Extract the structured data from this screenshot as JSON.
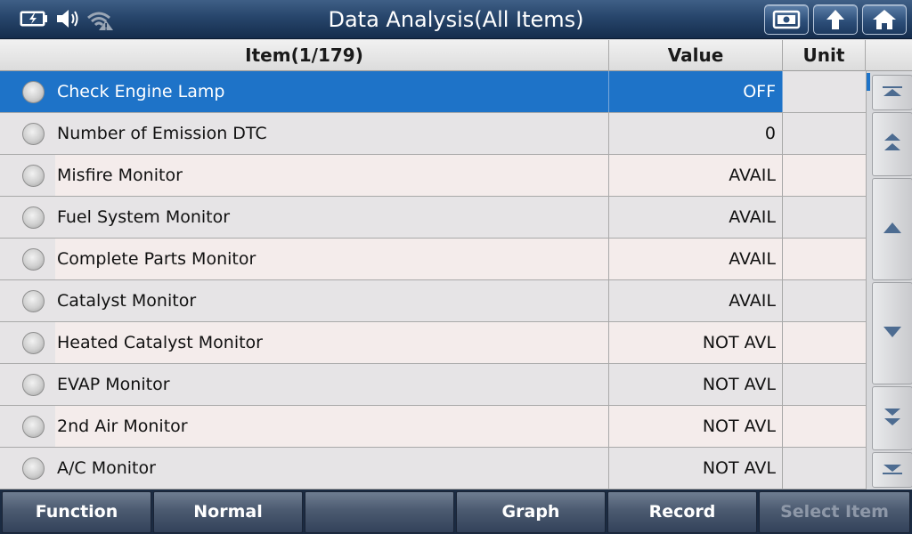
{
  "header": {
    "title": "Data Analysis(All Items)",
    "status_icons": [
      "battery-charging-icon",
      "speaker-icon",
      "wifi-warning-icon"
    ],
    "buttons": [
      "snapshot-icon",
      "back-arrow-icon",
      "home-icon"
    ]
  },
  "table": {
    "columns": {
      "item": "Item(1/179)",
      "value": "Value",
      "unit": "Unit"
    },
    "rows": [
      {
        "item": "Check Engine Lamp",
        "value": "OFF",
        "unit": "",
        "selected": true
      },
      {
        "item": "Number of Emission DTC",
        "value": "0",
        "unit": ""
      },
      {
        "item": "Misfire Monitor",
        "value": "AVAIL",
        "unit": ""
      },
      {
        "item": "Fuel System Monitor",
        "value": "AVAIL",
        "unit": ""
      },
      {
        "item": "Complete Parts Monitor",
        "value": "AVAIL",
        "unit": ""
      },
      {
        "item": "Catalyst Monitor",
        "value": "AVAIL",
        "unit": ""
      },
      {
        "item": "Heated Catalyst Monitor",
        "value": "NOT AVL",
        "unit": ""
      },
      {
        "item": "EVAP Monitor",
        "value": "NOT AVL",
        "unit": ""
      },
      {
        "item": "2nd Air Monitor",
        "value": "NOT AVL",
        "unit": ""
      },
      {
        "item": "A/C Monitor",
        "value": "NOT AVL",
        "unit": ""
      }
    ]
  },
  "scroll_buttons": [
    "scroll-top-icon",
    "page-up-icon",
    "scroll-up-icon",
    "scroll-down-icon",
    "page-down-icon",
    "scroll-bottom-icon"
  ],
  "toolbar": {
    "function": "Function",
    "normal": "Normal",
    "empty": "",
    "graph": "Graph",
    "record": "Record",
    "select_item": "Select Item"
  },
  "colors": {
    "title_bar": "#27456b",
    "selected_row": "#1e73c8",
    "row_odd": "#f4eceb",
    "row_even": "#e6e4e6",
    "toolbar": "#4b5a70",
    "disabled_text": "#8e98a8"
  }
}
